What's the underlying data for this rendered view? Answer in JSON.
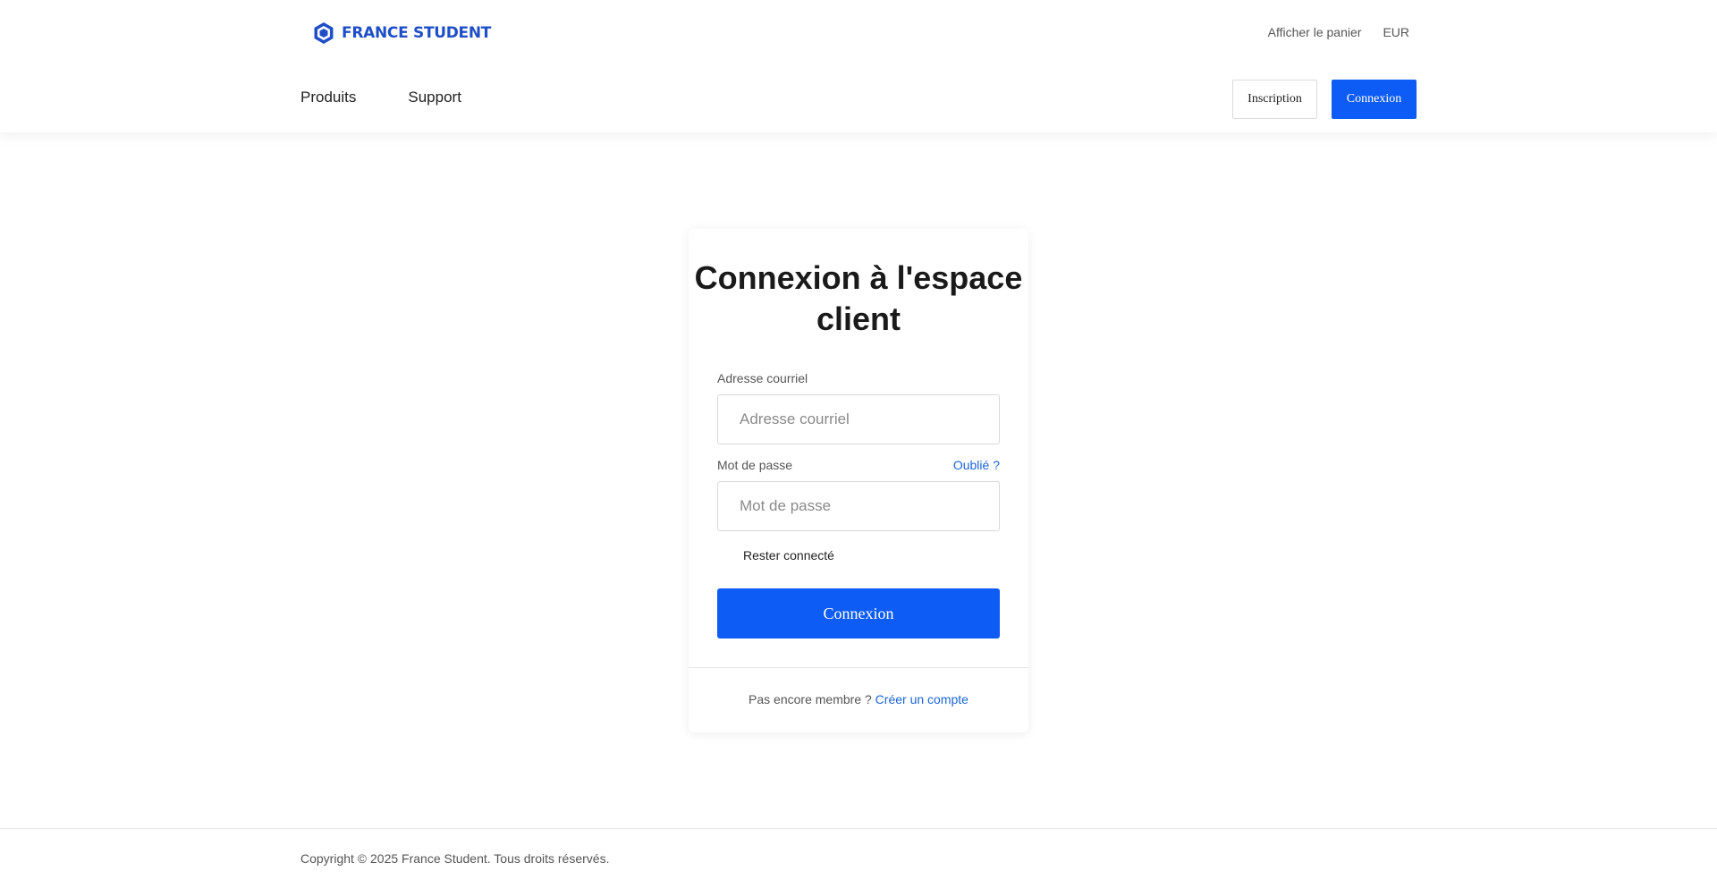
{
  "header": {
    "logo_text": "FRANCE STUDENT",
    "cart_link": "Afficher le panier",
    "currency": "EUR",
    "nav": {
      "products": "Produits",
      "support": "Support"
    },
    "signup_label": "Inscription",
    "login_label": "Connexion"
  },
  "login_card": {
    "title": "Connexion à l'espace client",
    "email_label": "Adresse courriel",
    "email_placeholder": "Adresse courriel",
    "email_value": "",
    "password_label": "Mot de passe",
    "password_placeholder": "Mot de passe",
    "password_value": "",
    "forgot_label": "Oublié ?",
    "remember_label": "Rester connecté",
    "submit_label": "Connexion",
    "footer_text": "Pas encore membre ?",
    "create_account_label": "Créer un compte"
  },
  "footer": {
    "copyright": "Copyright © 2025 France Student. Tous droits réservés."
  },
  "colors": {
    "primary": "#0d5cf5",
    "link": "#1a64d6",
    "logo": "#1f4fc7"
  },
  "icons": {
    "logo_icon": "hexagon-shield-icon"
  }
}
